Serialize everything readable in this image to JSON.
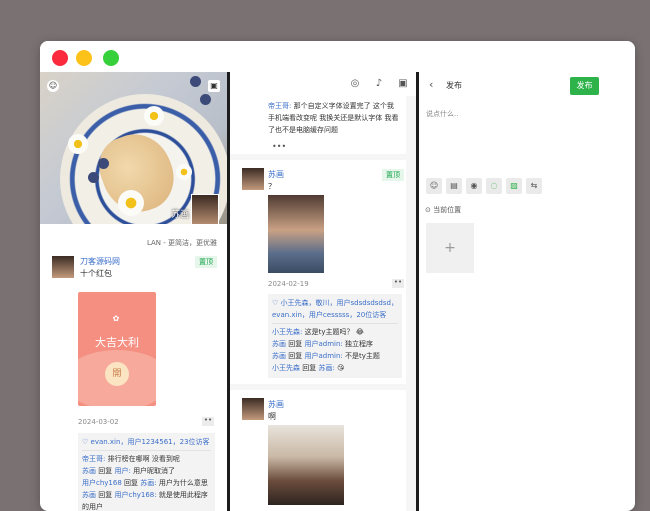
{
  "window": {
    "controls": [
      "close",
      "minimize",
      "maximize"
    ]
  },
  "profile": {
    "cover_name": "苏画",
    "slogan": "LAN - 更简洁，更优雅"
  },
  "post1": {
    "author": "刀客源码网",
    "badge": "置顶",
    "text": "十个红包",
    "envelope_title": "大吉大利",
    "envelope_button": "開",
    "date": "2024-03-02",
    "more": "••",
    "likes": "evan.xin，用户1234561，23位访客",
    "comments": [
      {
        "user": "帝王哥:",
        "text": "排行榜在哪啊 没看到呢"
      },
      {
        "user": "苏画",
        "reply": "回复",
        "to": "用户:",
        "text": "用户昵取消了"
      },
      {
        "user": "用户chy168",
        "reply": "回复",
        "to": "苏画:",
        "text": "用户为什么意思"
      },
      {
        "user": "苏画",
        "reply": "回复",
        "to": "用户chy168:",
        "text": "就是使用此程序"
      },
      {
        "user": "",
        "text": "的用户"
      }
    ]
  },
  "feed": {
    "top_comment": {
      "user": "帝王哥:",
      "lines": [
        "那个自定义字体设置完了 这个我",
        "手机端看改变呢 我换关还是默认字体 我看",
        "了也不是电脑缓存问题"
      ]
    },
    "top_more": "•••",
    "post2": {
      "author": "苏画",
      "badge": "置顶",
      "text": "？",
      "date": "2024-02-19",
      "more": "••",
      "likes_line1": "小王先森，敬川，用户sdsdsdsdsd，",
      "likes_line2": "evan.xin，用户cesssss，20位访客",
      "comments": [
        {
          "user": "小王先森:",
          "text": "这是ty主题吗？",
          "emoji": "😂"
        },
        {
          "user": "苏画",
          "reply": "回复",
          "to": "用户admin:",
          "text": "独立程序"
        },
        {
          "user": "苏画",
          "reply": "回复",
          "to": "用户admin:",
          "text": "不是ty主题"
        },
        {
          "user": "小王先森",
          "reply": "回复",
          "to": "苏画:",
          "text": "",
          "emoji": "😘"
        }
      ]
    },
    "post3": {
      "author": "苏画",
      "text": "啊"
    }
  },
  "compose": {
    "title": "发布",
    "publish": "发布",
    "placeholder": "说点什么..",
    "location": "当前位置",
    "add": "+"
  },
  "colors": {
    "accent": "#2db34a",
    "link": "#3a6ec9",
    "envelope": "#f48f82"
  }
}
